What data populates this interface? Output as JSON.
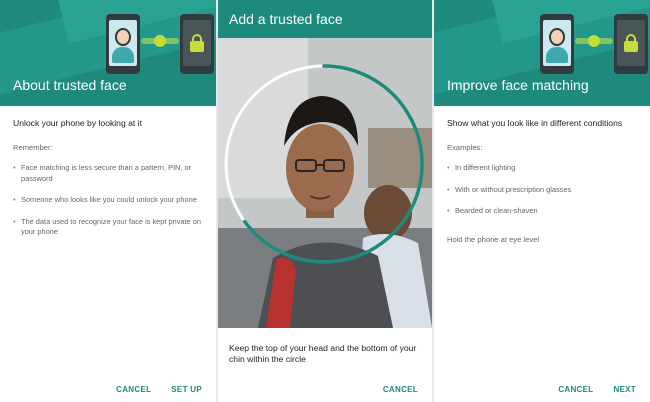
{
  "screens": [
    {
      "title": "About trusted face",
      "lead": "Unlock your phone by looking at it",
      "label": "Remember:",
      "bullet": "•",
      "items": [
        "Face matching is less secure than a pattern, PIN, or password",
        "Someone who looks like you could unlock your phone",
        "The data used to recognize your face is kept private on your phone"
      ],
      "buttons": {
        "secondary": "CANCEL",
        "primary": "SET UP"
      }
    },
    {
      "title": "Add a trusted face",
      "instructions": "Keep the top of your head and the bottom of your chin within the circle",
      "buttons": {
        "secondary": "CANCEL"
      },
      "progress_fraction": 0.65
    },
    {
      "title": "Improve face matching",
      "lead": "Show what you look like in different conditions",
      "label": "Examples:",
      "bullet": "•",
      "items": [
        "In different lighting",
        "With or without prescription glasses",
        "Bearded or clean-shaven"
      ],
      "note": "Hold the phone at eye level",
      "buttons": {
        "secondary": "CANCEL",
        "primary": "NEXT"
      }
    }
  ],
  "colors": {
    "primary": "#1d8a7c",
    "accent": "#c3dd3c",
    "text": "#222222",
    "muted": "#666666"
  }
}
